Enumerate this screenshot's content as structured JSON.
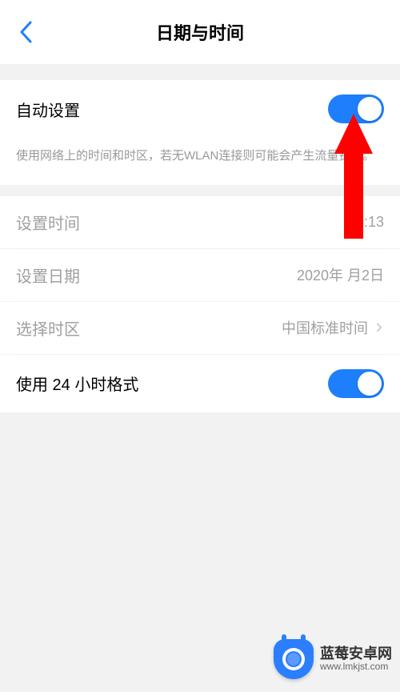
{
  "header": {
    "title": "日期与时间"
  },
  "rows": {
    "auto": {
      "label": "自动设置",
      "description": "使用网络上的时间和时区，若无WLAN连接则可能会产生流量费用。"
    },
    "time": {
      "label": "设置时间",
      "value": "9:13"
    },
    "date": {
      "label": "设置日期",
      "value": "2020年 月2日"
    },
    "timezone": {
      "label": "选择时区",
      "value": "中国标准时间"
    },
    "format24": {
      "label": "使用 24 小时格式"
    }
  },
  "watermark": {
    "brand": "蓝莓安卓网",
    "url": "www.lmkjst.com"
  },
  "colors": {
    "accent": "#1E7FFD",
    "arrow": "#FF0000"
  }
}
